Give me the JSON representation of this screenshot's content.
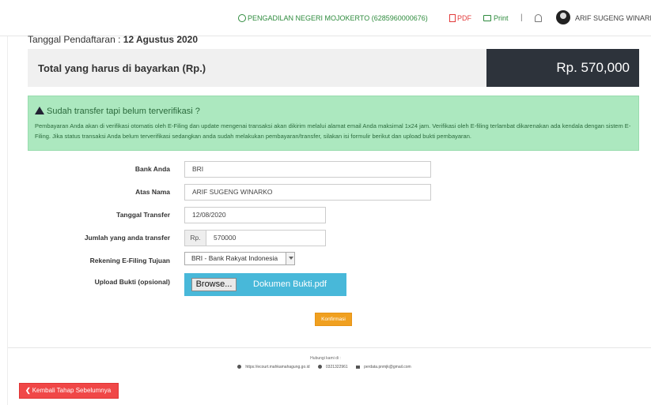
{
  "topbar": {
    "contact": "PENGADILAN NEGERI MOJOKERTO (6285960000676)",
    "pdf_label": "PDF",
    "print_label": "Print",
    "separator": "|",
    "user_name": "ARIF SUGENG WINARKO"
  },
  "registration": {
    "label": "Tanggal Pendaftaran :",
    "date": "12 Agustus 2020"
  },
  "total": {
    "label": "Total yang harus di bayarkan (Rp.)",
    "amount": "Rp. 570,000"
  },
  "alert": {
    "title": "Sudah transfer tapi belum terverifikasi ?",
    "body": "Pembayaran Anda akan di verifikasi otomatis oleh E-Filing dan update mengenai transaksi akan dikirim melalui alamat email Anda maksimal 1x24 jam. Verifikasi oleh E-filing terlambat dikarenakan ada kendala dengan sistem E-Filing. Jika status transaksi Anda belum terverifikasi sedangkan anda sudah melakukan pembayaran/transfer, silakan isi formulir berikut dan upload bukti pembayaran."
  },
  "form": {
    "bank_label": "Bank Anda",
    "bank_value": "BRI",
    "name_label": "Atas Nama",
    "name_value": "ARIF SUGENG WINARKO",
    "date_label": "Tanggal Transfer",
    "date_value": "12/08/2020",
    "amount_label": "Jumlah yang anda transfer",
    "amount_prefix": "Rp.",
    "amount_value": "570000",
    "account_label": "Rekening E-Filing Tujuan",
    "account_value": "BRI - Bank Rakyat Indonesia",
    "upload_label": "Upload Bukti (opsional)",
    "browse_label": "Browse...",
    "file_name": "Dokumen Bukti.pdf",
    "confirm_label": "Konfirmasi"
  },
  "footer": {
    "title": "Hubungi kami di :",
    "website": "https://ecourt.mahkamahagung.go.id",
    "phone": "0321322961",
    "email": "perdata.pnmjk@gmail.com"
  },
  "back_button": "Kembali Tahap Sebelumnya",
  "colors": {
    "alert_bg": "#ace8bf",
    "amount_bg": "#2d333b",
    "upload_bg": "#48b8d9",
    "confirm_bg": "#f0a020",
    "back_bg": "#f04747"
  }
}
